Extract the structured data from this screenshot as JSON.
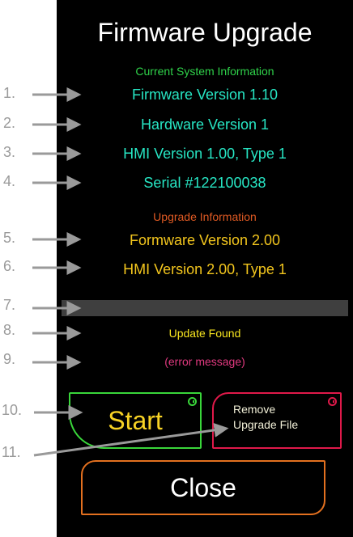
{
  "title": "Firmware Upgrade",
  "current": {
    "heading": "Current System Information",
    "firmware": "Firmware Version 1.10",
    "hardware": "Hardware Version 1",
    "hmi": "HMI Version 1.00, Type 1",
    "serial": "Serial #122100038"
  },
  "upgrade": {
    "heading": "Upgrade Information",
    "firmware": "Formware Version 2.00",
    "hmi": "HMI Version 2.00, Type 1"
  },
  "status": {
    "update_found": "Update Found",
    "error_message": "(error message)"
  },
  "buttons": {
    "start": "Start",
    "remove_line1": "Remove",
    "remove_line2": "Upgrade File",
    "close": "Close"
  },
  "callouts": {
    "n1": "1.",
    "n2": "2.",
    "n3": "3.",
    "n4": "4.",
    "n5": "5.",
    "n6": "6.",
    "n7": "7.",
    "n8": "8.",
    "n9": "9.",
    "n10": "10.",
    "n11": "11."
  },
  "colors": {
    "current_heading": "#2fd24a",
    "current_text": "#27e6c4",
    "upgrade_heading": "#e05a23",
    "upgrade_text": "#f2c51d",
    "update_found": "#f7e51f",
    "error": "#e0397f",
    "callout": "#9a9a9a"
  },
  "icons": [
    "arrow-icon",
    "clock-icon"
  ]
}
